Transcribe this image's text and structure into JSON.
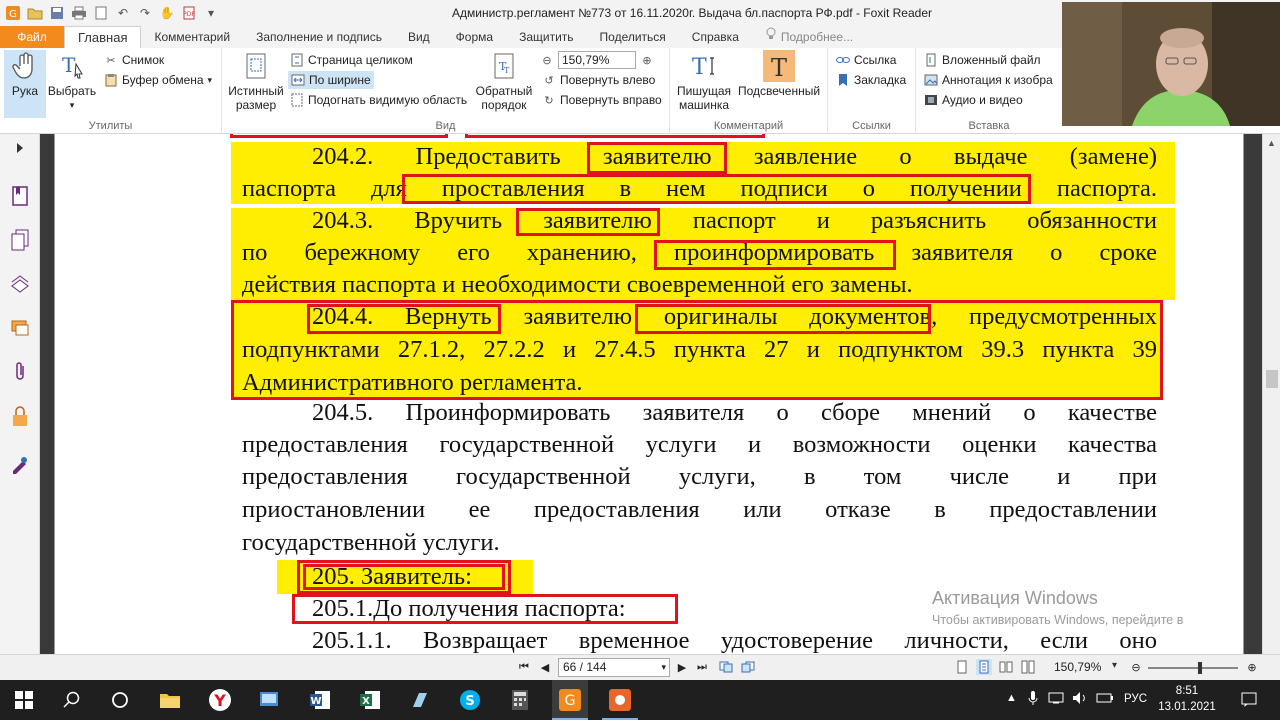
{
  "window": {
    "title": "Администр.регламент №773 от 16.11.2020г. Выдача бл.паспорта РФ.pdf - Foxit Reader"
  },
  "tabs": {
    "file": "Файл",
    "items": [
      "Главная",
      "Комментарий",
      "Заполнение и подпись",
      "Вид",
      "Форма",
      "Защитить",
      "Поделиться",
      "Справка"
    ],
    "search_placeholder": "Подробнее...",
    "search_partial": "а"
  },
  "ribbon": {
    "utilities": {
      "label": "Утилиты",
      "hand": "Рука",
      "select": "Выбрать",
      "snapshot": "Снимок",
      "clipboard": "Буфер обмена"
    },
    "view": {
      "label": "Вид",
      "actual_size_1": "Истинный",
      "actual_size_2": "размер",
      "fit_page": "Страница целиком",
      "fit_width": "По ширине",
      "fit_visible": "Подогнать видимую область",
      "reverse_1": "Обратный",
      "reverse_2": "порядок",
      "zoom_value": "150,79%",
      "rotate_left": "Повернуть влево",
      "rotate_right": "Повернуть вправо"
    },
    "comment": {
      "label": "Комментарий",
      "typewriter_1": "Пишущая",
      "typewriter_2": "машинка",
      "highlight": "Подсвеченный"
    },
    "links": {
      "label": "Ссылки",
      "link": "Ссылка",
      "bookmark": "Закладка"
    },
    "insert": {
      "label": "Вставка",
      "attachment": "Вложенный файл",
      "annotation": "Аннотация к изобра",
      "media": "Аудио и видео"
    }
  },
  "document": {
    "lines": [
      "204.2. Предоставить заявителю заявление о выдаче (замене)",
      "паспорта для проставления в нем подписи о получении паспорта.",
      "204.3. Вручить заявителю паспорт и разъяснить обязанности",
      "по бережному его хранению, проинформировать заявителя о сроке",
      "действия паспорта и необходимости своевременной его замены.",
      "204.4. Вернуть заявителю оригиналы документов, предусмотренных",
      "подпунктами 27.1.2, 27.2.2 и 27.4.5 пункта 27 и подпунктом 39.3 пункта 39",
      "Административного регламента.",
      "204.5. Проинформировать заявителя о сборе мнений о качестве",
      "предоставления государственной услуги и возможности оценки качества",
      "предоставления государственной услуги, в том числе и при",
      "приостановлении ее предоставления или отказе в предоставлении",
      "государственной услуги.",
      "205. Заявитель:",
      "205.1.До получения паспорта:",
      "205.1.1. Возвращает временное удостоверение личности, если оно"
    ]
  },
  "statusbar": {
    "page_indicator": "66 / 144",
    "zoom": "150,79%"
  },
  "activation": {
    "title": "Активация Windows",
    "subtitle": "Чтобы активировать Windows, перейдите в"
  },
  "taskbar": {
    "language": "РУС",
    "time": "8:51",
    "date": "13.01.2021"
  },
  "colors": {
    "file_tab": "#f28a1e",
    "highlight_yellow": "#ffee00",
    "annotation_red": "#e0121b",
    "taskbar": "#1f1f1f"
  }
}
